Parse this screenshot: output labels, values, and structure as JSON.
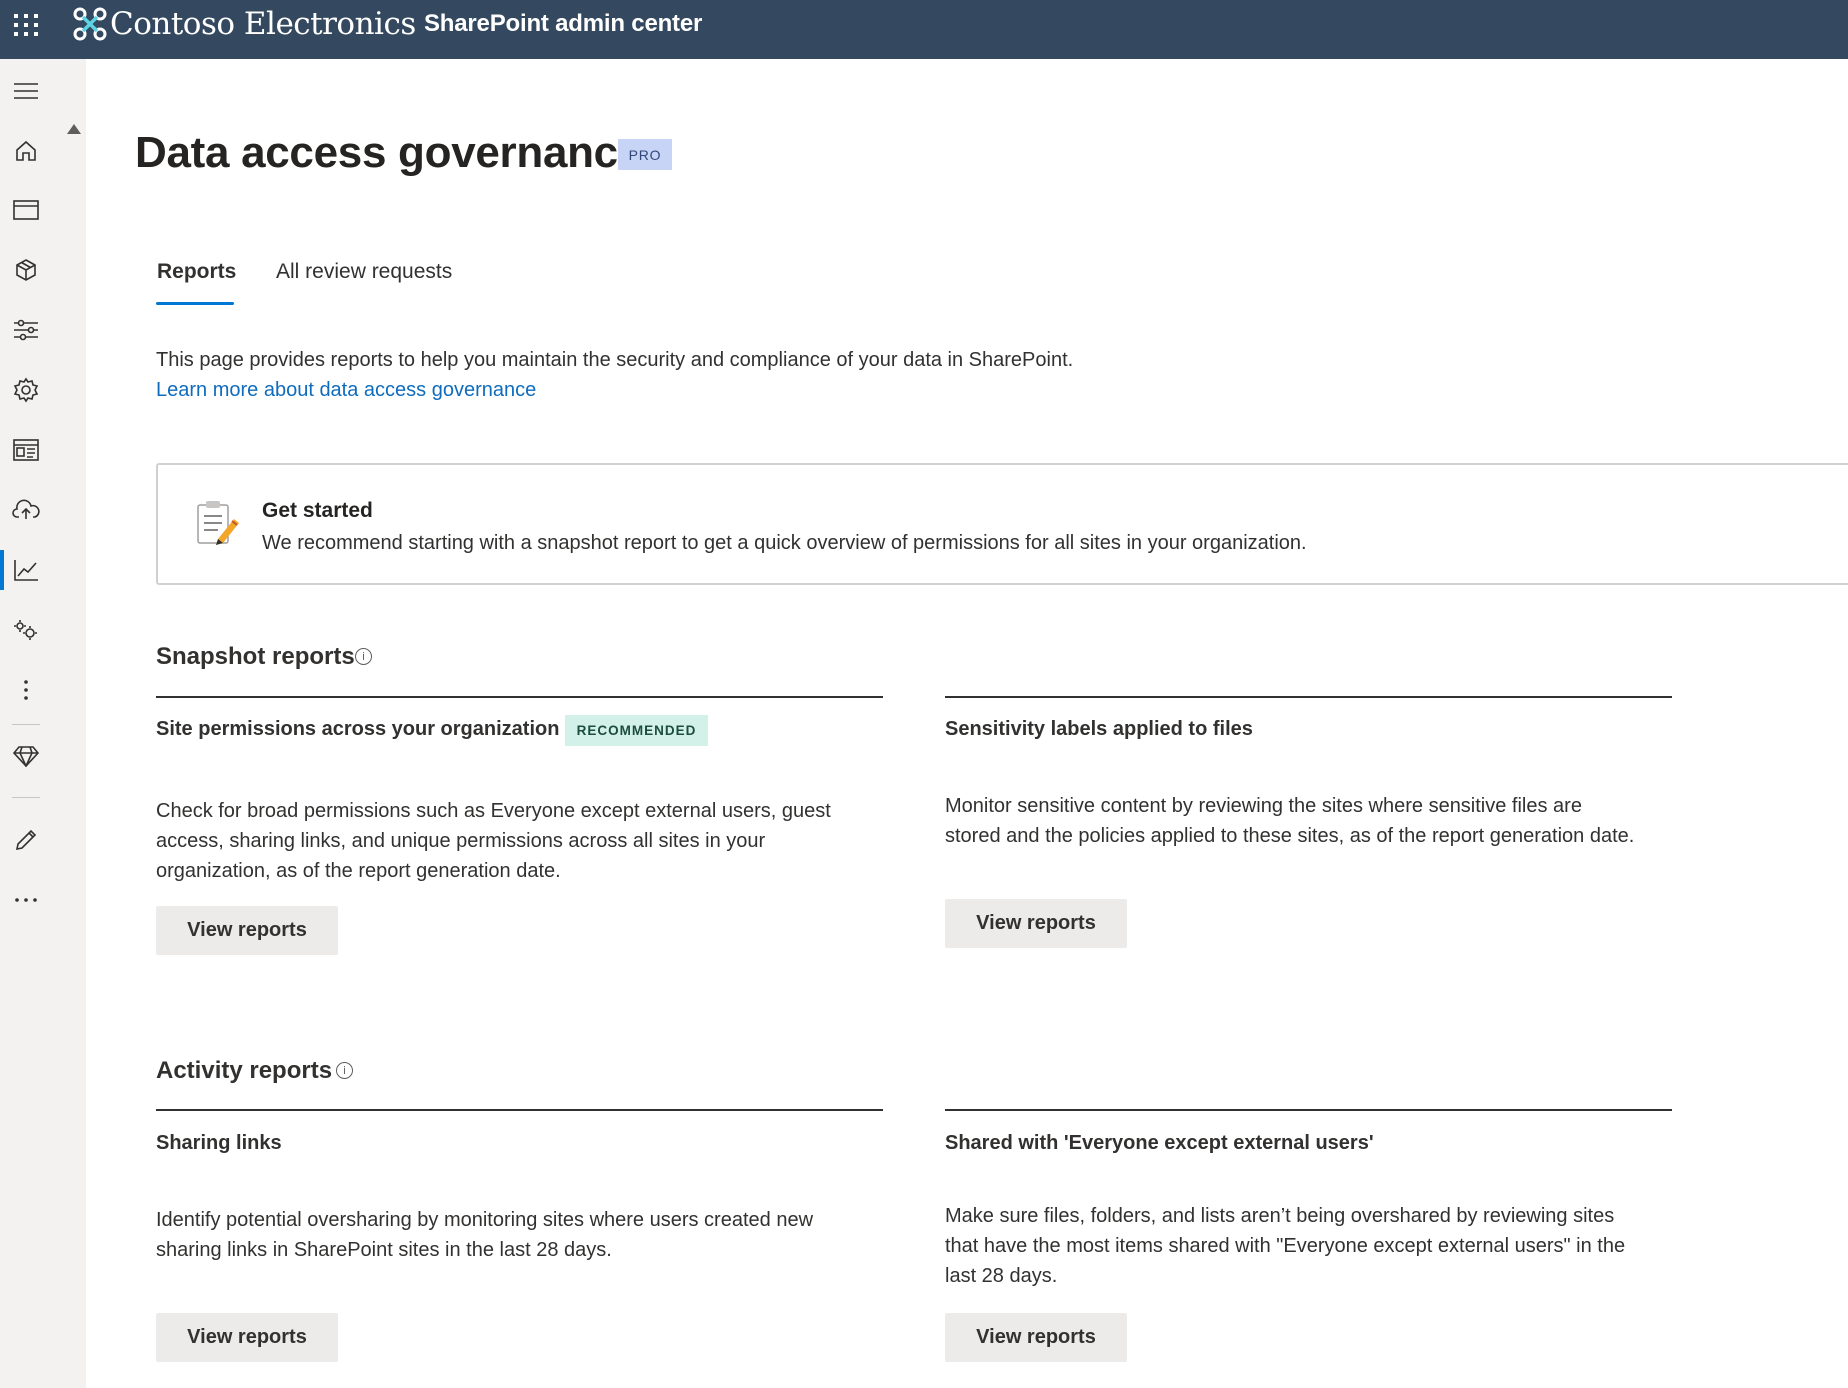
{
  "topbar": {
    "org_name": "Contoso Electronics",
    "app_title": "SharePoint admin center"
  },
  "rail": {
    "icons": [
      "menu-icon",
      "home-icon",
      "sites-icon",
      "cube-icon",
      "policies-icon",
      "settings-icon",
      "content-services-icon",
      "migration-icon",
      "reports-icon",
      "advanced-management-icon",
      "more-vertical-icon",
      "diamond-icon",
      "edit-icon",
      "ellipsis-icon"
    ],
    "active": "reports-icon"
  },
  "header": {
    "title": "Data access governance",
    "badge": "PRO"
  },
  "tabs": [
    {
      "label": "Reports",
      "selected": true
    },
    {
      "label": "All review requests",
      "selected": false
    }
  ],
  "intro": {
    "description": "This page provides reports to help you maintain the security and compliance of your data in SharePoint.",
    "link": "Learn more about data access governance"
  },
  "get_started": {
    "title": "Get started",
    "text": "We recommend starting with a snapshot report to get a quick overview of permissions for all sites in your organization."
  },
  "snapshot": {
    "title": "Snapshot reports",
    "cards": [
      {
        "title": "Site permissions across your organization",
        "badge": "RECOMMENDED",
        "lines": [
          "Check for broad permissions such as Everyone except external users, guest",
          "access, sharing links, and unique permissions across all sites in your",
          "organization, as of the report generation date."
        ],
        "button": "View reports"
      },
      {
        "title": "Sensitivity labels applied to files",
        "lines": [
          "Monitor sensitive content by reviewing the sites where sensitive files are",
          "stored and the policies applied to these sites, as of the report generation date."
        ],
        "button": "View reports"
      }
    ]
  },
  "activity": {
    "title": "Activity reports",
    "cards": [
      {
        "title": "Sharing links",
        "lines": [
          "Identify potential oversharing by monitoring sites where users created new",
          "sharing links in SharePoint sites in the last 28 days."
        ],
        "button": "View reports"
      },
      {
        "title": "Shared with 'Everyone except external users'",
        "lines": [
          "Make sure files, folders, and lists aren’t being overshared by reviewing sites",
          "that have the most items shared with \"Everyone except external users\" in the",
          "last 28 days."
        ],
        "button": "View reports"
      }
    ]
  },
  "colors": {
    "topbar": "#34495f",
    "accent": "#0078d4",
    "link": "#0f6cbd",
    "pro_badge_bg": "#c7d4f6",
    "recommended_badge_bg": "#d3f1e8"
  }
}
